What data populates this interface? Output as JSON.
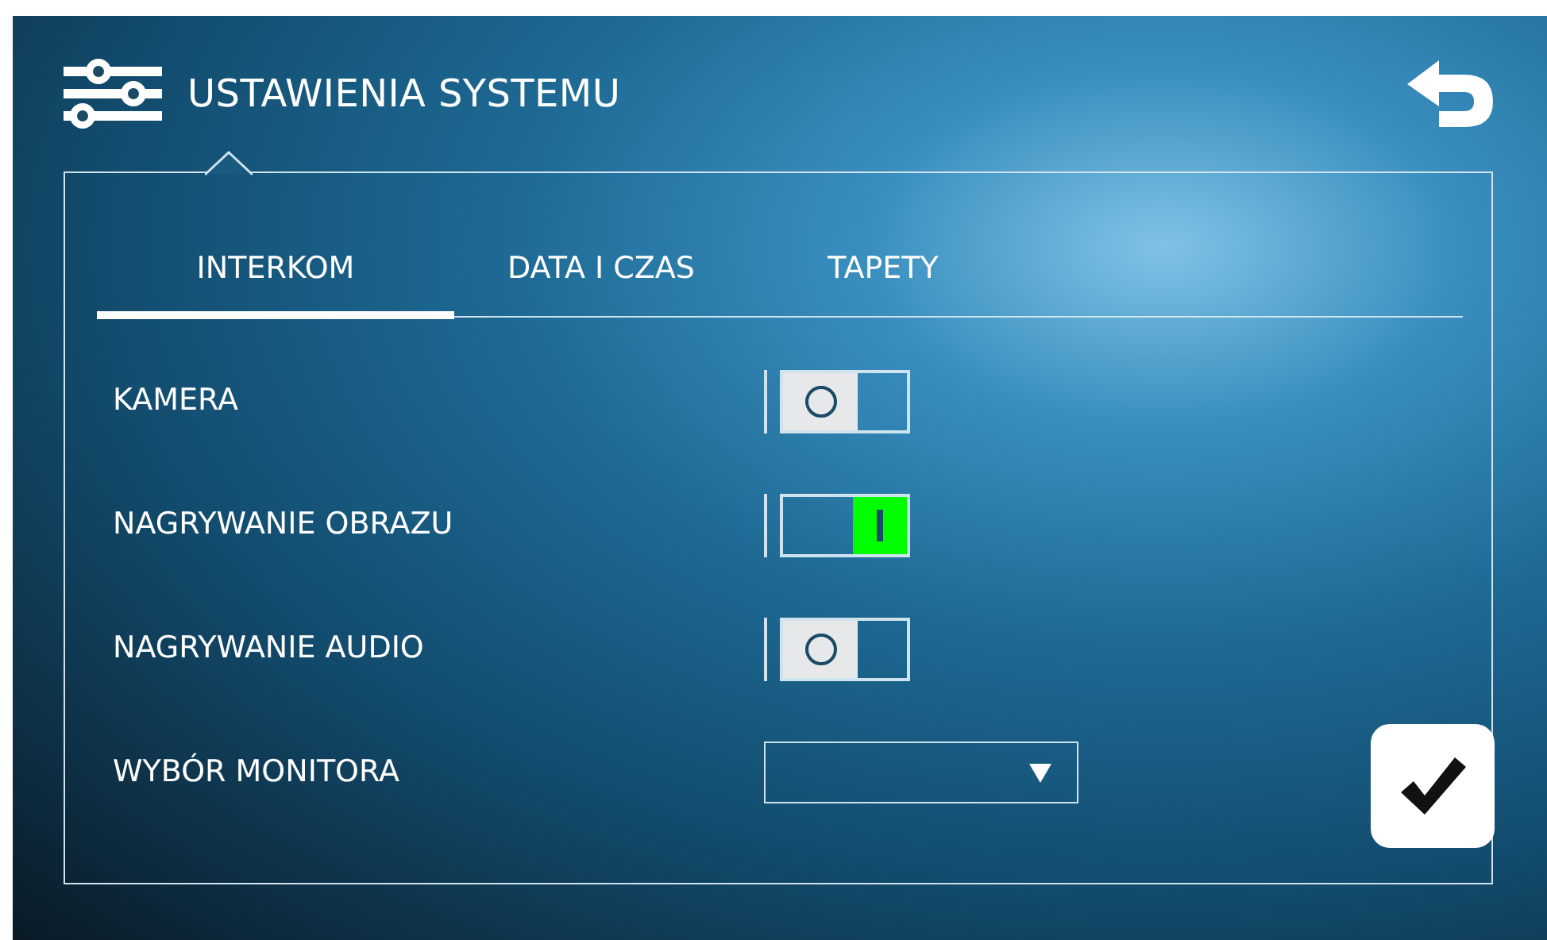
{
  "header": {
    "title": "USTAWIENIA SYSTEMU"
  },
  "tabs": [
    {
      "label": "INTERKOM",
      "selected": true
    },
    {
      "label": "DATA I CZAS",
      "selected": false
    },
    {
      "label": "TAPETY",
      "selected": false
    }
  ],
  "settings": [
    {
      "kind": "toggle",
      "label": "KAMERA",
      "on": false
    },
    {
      "kind": "toggle",
      "label": "NAGRYWANIE OBRAZU",
      "on": true
    },
    {
      "kind": "toggle",
      "label": "NAGRYWANIE AUDIO",
      "on": false
    },
    {
      "kind": "dropdown",
      "label": "WYBÓR MONITORA"
    }
  ]
}
